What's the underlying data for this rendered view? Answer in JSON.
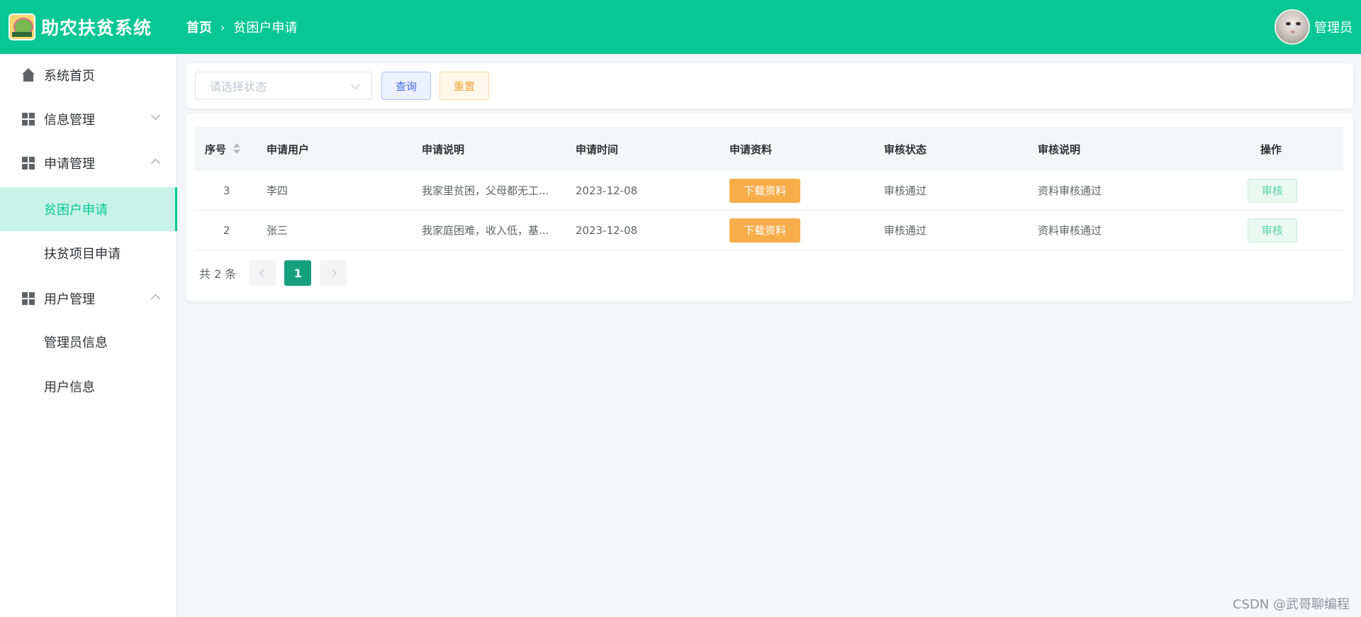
{
  "header": {
    "app_title": "助农扶贫系统",
    "breadcrumb_home": "首页",
    "breadcrumb_current": "贫困户申请",
    "admin_name": "管理员"
  },
  "sidebar": {
    "items": [
      {
        "label": "系统首页",
        "icon": "home-icon"
      },
      {
        "label": "信息管理",
        "icon": "grid-icon",
        "expanded": false
      },
      {
        "label": "申请管理",
        "icon": "grid-icon",
        "expanded": true
      },
      {
        "label": "贫困户申请",
        "active": true
      },
      {
        "label": "扶贫项目申请"
      },
      {
        "label": "用户管理",
        "icon": "grid-icon",
        "expanded": true
      },
      {
        "label": "管理员信息"
      },
      {
        "label": "用户信息"
      }
    ]
  },
  "search": {
    "placeholder": "请选择状态",
    "query_label": "查询",
    "reset_label": "重置"
  },
  "table": {
    "columns": [
      "序号",
      "申请用户",
      "申请说明",
      "申请时间",
      "申请资料",
      "审核状态",
      "审核说明",
      "操作"
    ],
    "rows": [
      {
        "id": "3",
        "user": "李四",
        "desc": "我家里贫困，父母都无工...",
        "time": "2023-12-08",
        "download": "下载资料",
        "status": "审核通过",
        "remark": "资料审核通过",
        "action": "审核"
      },
      {
        "id": "2",
        "user": "张三",
        "desc": "我家庭困难，收入低，基...",
        "time": "2023-12-08",
        "download": "下载资料",
        "status": "审核通过",
        "remark": "资料审核通过",
        "action": "审核"
      }
    ]
  },
  "pagination": {
    "total_text": "共 2 条",
    "current_page": "1"
  },
  "watermark": "CSDN @武哥聊编程",
  "colors": {
    "primary": "#08c795",
    "download": "#f6ad4a",
    "page_active": "#15a07d"
  }
}
